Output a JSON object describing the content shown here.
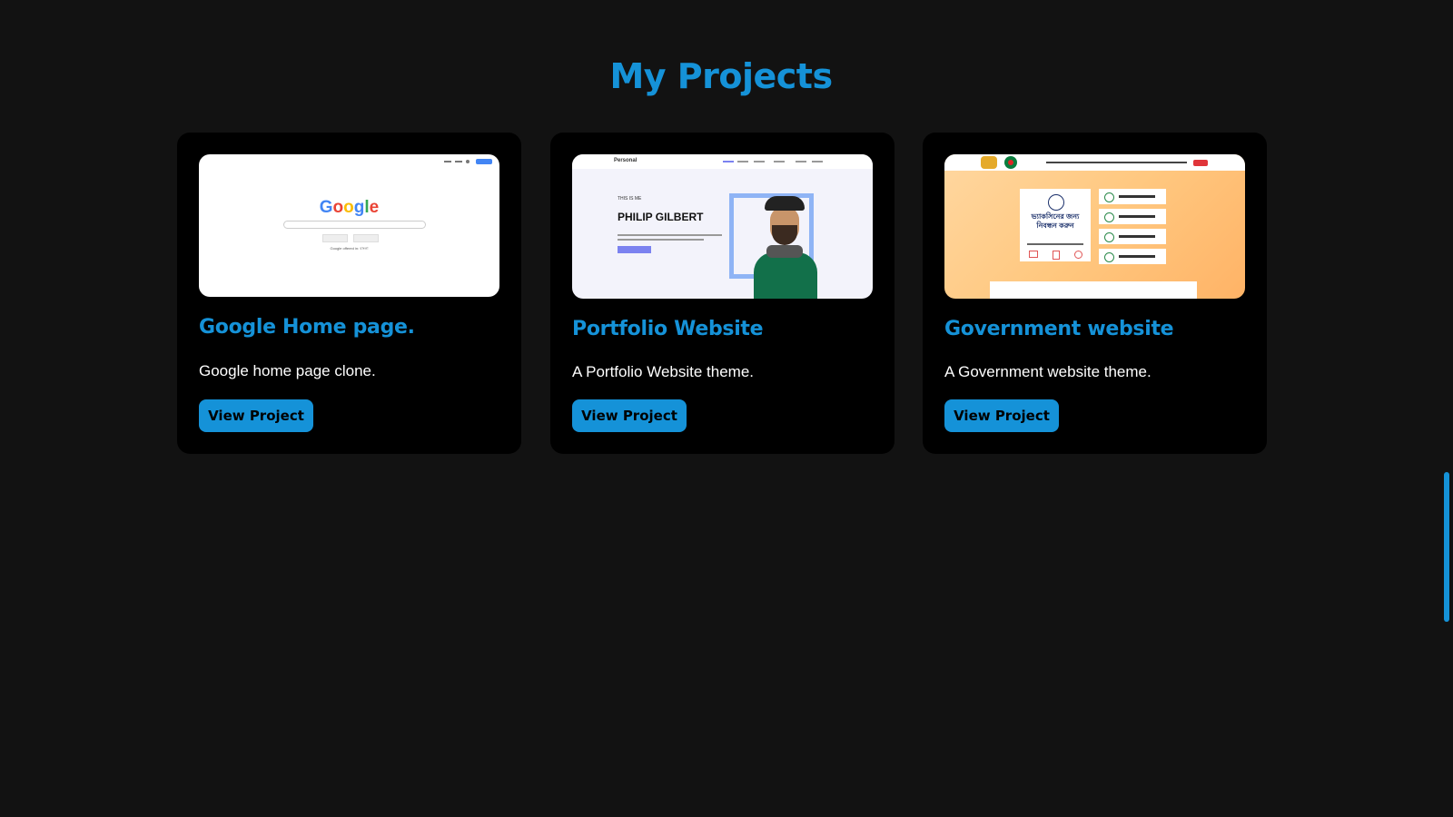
{
  "section": {
    "title": "My Projects"
  },
  "projects": [
    {
      "title": "Google Home page.",
      "description": "Google home page clone.",
      "button_label": "View Project",
      "thumbnail": {
        "logo_text": "Google",
        "footer_text": "Google offered in: বাংলা",
        "button_1": "Google Search",
        "button_2": "I'm Feeling Lucky"
      }
    },
    {
      "title": "Portfolio Website",
      "description": "A Portfolio Website theme.",
      "button_label": "View Project",
      "thumbnail": {
        "logo_text": "Personal",
        "kicker": "THIS IS ME",
        "name": "PHILIP GILBERT"
      }
    },
    {
      "title": "Government website",
      "description": "A Government website theme.",
      "button_label": "View Project",
      "thumbnail": {
        "card_text": "ভ্যাকসিনের জন্য নিবন্ধন করুন"
      }
    }
  ],
  "colors": {
    "accent": "#1592d8",
    "background": "#121212",
    "card": "#000000"
  }
}
